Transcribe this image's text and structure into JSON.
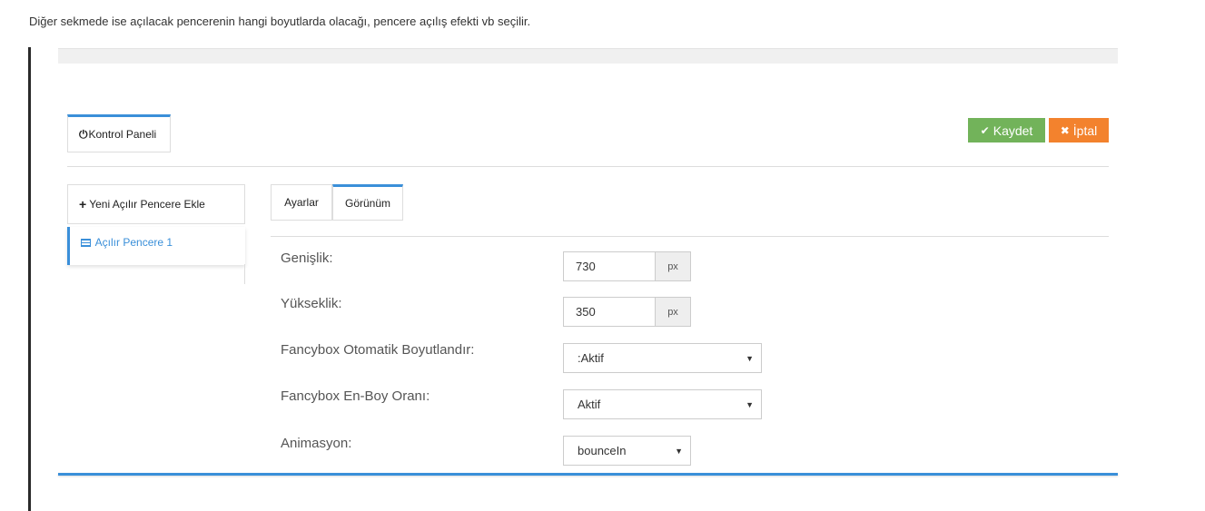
{
  "intro_text": "Diğer sekmede ise açılacak pencerenin hangi boyutlarda olacağı, pencere açılış efekti vb seçilir.",
  "header": {
    "control_panel_tab": "Kontrol Paneli",
    "control_panel_icon": "power-icon",
    "save_label": "Kaydet",
    "save_icon": "check-icon",
    "cancel_label": "İptal",
    "cancel_icon": "close-icon"
  },
  "sidebar": {
    "add_label": "Yeni Açılır Pencere Ekle",
    "add_icon": "plus-icon",
    "items": [
      {
        "label": "Açılır Pencere 1",
        "icon": "list-icon"
      }
    ]
  },
  "tabs": [
    {
      "label": "Ayarlar",
      "active": false
    },
    {
      "label": "Görünüm",
      "active": true
    }
  ],
  "form": {
    "width_label": "Genişlik:",
    "width_value": "730",
    "width_unit": "px",
    "height_label": "Yükseklik:",
    "height_value": "350",
    "height_unit": "px",
    "autosize_label": "Fancybox Otomatik Boyutlandır:",
    "autosize_value": ":Aktif",
    "ratio_label": "Fancybox En-Boy Oranı:",
    "ratio_value": "Aktif",
    "animation_label": "Animasyon:",
    "animation_value": "bounceIn"
  },
  "colors": {
    "accent": "#3a8fd9",
    "save": "#72b35a",
    "cancel": "#f3822d"
  }
}
